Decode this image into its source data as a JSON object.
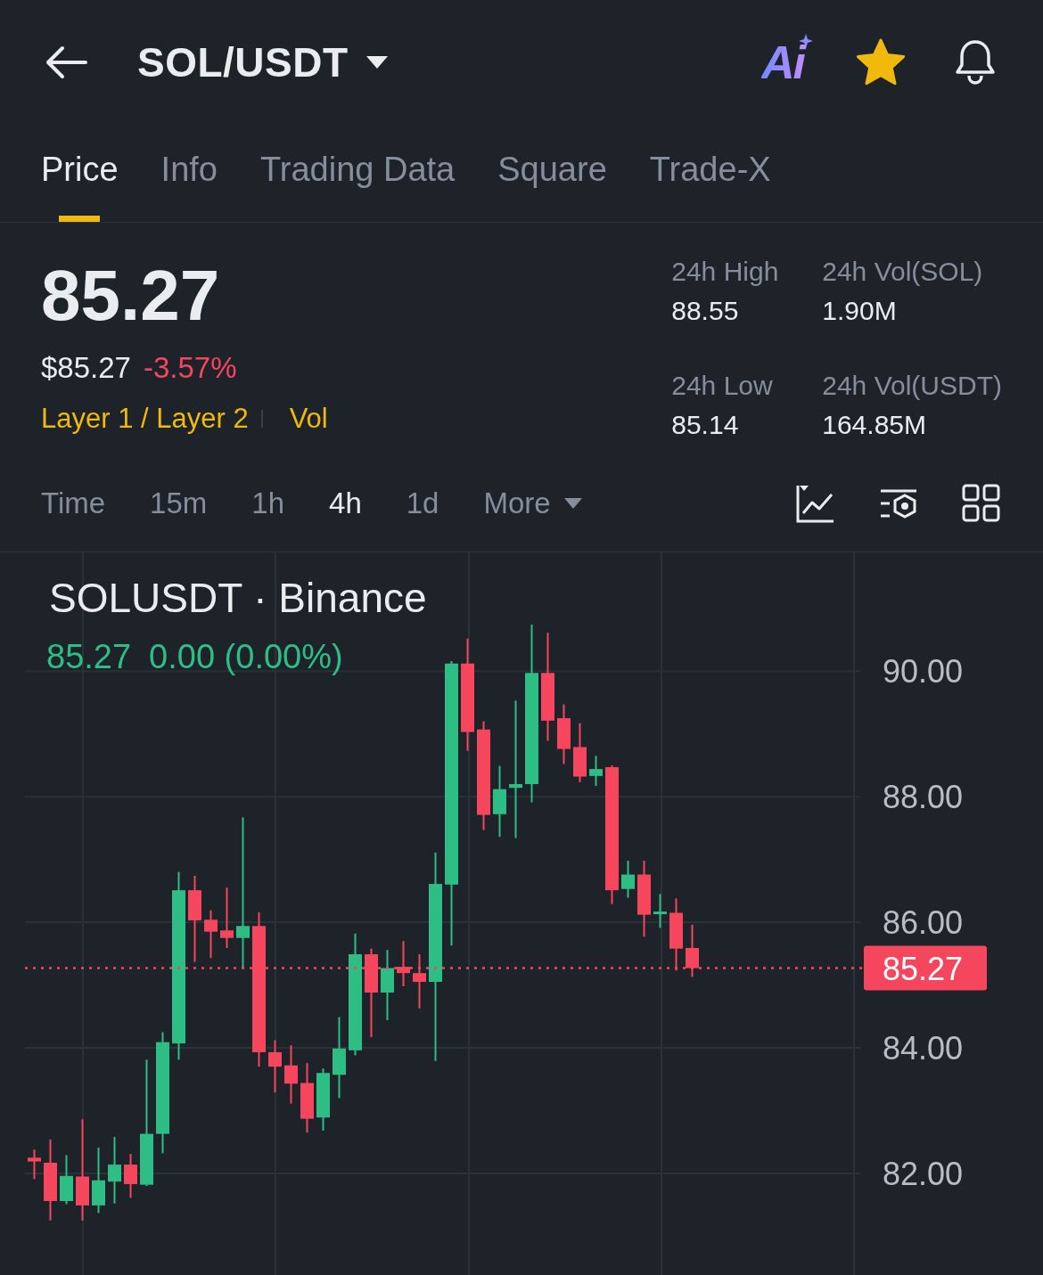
{
  "header": {
    "title": "SOL/USDT",
    "ai_label": "Ai",
    "favorite": true
  },
  "tabs": [
    {
      "label": "Price",
      "selected": true
    },
    {
      "label": "Info",
      "selected": false
    },
    {
      "label": "Trading Data",
      "selected": false
    },
    {
      "label": "Square",
      "selected": false
    },
    {
      "label": "Trade-X",
      "selected": false
    }
  ],
  "price": {
    "last": "85.27",
    "usd": "$85.27",
    "change": "-3.57%"
  },
  "tags": [
    "Layer 1 / Layer 2",
    "Vol"
  ],
  "stats": [
    {
      "label": "24h High",
      "value": "88.55"
    },
    {
      "label": "24h Vol(SOL)",
      "value": "1.90M"
    },
    {
      "label": "24h Low",
      "value": "85.14"
    },
    {
      "label": "24h Vol(USDT)",
      "value": "164.85M"
    }
  ],
  "intervals": [
    {
      "label": "Time",
      "selected": false,
      "kind": "option"
    },
    {
      "label": "15m",
      "selected": false,
      "kind": "option"
    },
    {
      "label": "1h",
      "selected": false,
      "kind": "option"
    },
    {
      "label": "4h",
      "selected": true,
      "kind": "option"
    },
    {
      "label": "1d",
      "selected": false,
      "kind": "option"
    },
    {
      "label": "More",
      "selected": false,
      "kind": "dropdown"
    }
  ],
  "chart": {
    "symbol": "SOLUSDT · Binance",
    "legend": {
      "price": "85.27",
      "change": "0.00 (0.00%)"
    },
    "chart_data": {
      "type": "candlestick",
      "grid": true,
      "ylim": [
        80.24,
        91.89
      ],
      "yticks": [
        {
          "value": 82,
          "label": "82.00"
        },
        {
          "value": 84,
          "label": "84.00"
        },
        {
          "value": 86,
          "label": "86.00"
        },
        {
          "value": 88,
          "label": "88.00"
        },
        {
          "value": 90,
          "label": "90.00"
        }
      ],
      "ohlc": [
        [
          82.25,
          82.38,
          81.91,
          82.19
        ],
        [
          82.17,
          82.54,
          81.25,
          81.56
        ],
        [
          81.56,
          82.29,
          81.51,
          81.96
        ],
        [
          81.95,
          82.86,
          81.25,
          81.49
        ],
        [
          81.49,
          82.41,
          81.37,
          81.89
        ],
        [
          81.87,
          82.58,
          81.52,
          82.14
        ],
        [
          82.14,
          82.31,
          81.61,
          81.83
        ],
        [
          81.82,
          83.81,
          81.8,
          82.63
        ],
        [
          82.63,
          84.25,
          82.32,
          84.09
        ],
        [
          84.07,
          86.8,
          83.81,
          86.51
        ],
        [
          86.51,
          86.74,
          85.37,
          86.03
        ],
        [
          86.04,
          86.19,
          85.43,
          85.85
        ],
        [
          85.87,
          86.55,
          85.59,
          85.75
        ],
        [
          85.75,
          87.67,
          85.27,
          85.94
        ],
        [
          85.94,
          86.16,
          83.7,
          83.93
        ],
        [
          83.93,
          84.12,
          83.29,
          83.7
        ],
        [
          83.72,
          84.04,
          83.11,
          83.43
        ],
        [
          83.44,
          83.76,
          82.65,
          82.87
        ],
        [
          82.89,
          83.67,
          82.68,
          83.6
        ],
        [
          83.57,
          84.49,
          83.2,
          83.99
        ],
        [
          83.96,
          85.82,
          83.88,
          85.49
        ],
        [
          85.49,
          85.58,
          84.17,
          84.88
        ],
        [
          84.88,
          85.56,
          84.44,
          85.27
        ],
        [
          85.29,
          85.7,
          84.98,
          85.19
        ],
        [
          85.19,
          85.49,
          84.63,
          85.05
        ],
        [
          85.05,
          87.11,
          83.79,
          86.61
        ],
        [
          86.6,
          90.16,
          85.63,
          90.12
        ],
        [
          90.12,
          90.52,
          88.73,
          89.03
        ],
        [
          89.07,
          89.2,
          87.47,
          87.71
        ],
        [
          87.72,
          88.49,
          87.36,
          88.12
        ],
        [
          88.14,
          89.53,
          87.34,
          88.2
        ],
        [
          88.2,
          90.74,
          87.91,
          89.97
        ],
        [
          89.97,
          90.61,
          88.89,
          89.21
        ],
        [
          89.25,
          89.47,
          88.52,
          88.76
        ],
        [
          88.79,
          89.17,
          88.23,
          88.32
        ],
        [
          88.33,
          88.65,
          88.17,
          88.44
        ],
        [
          88.47,
          88.5,
          86.29,
          86.51
        ],
        [
          86.53,
          86.98,
          86.39,
          86.76
        ],
        [
          86.76,
          86.98,
          85.77,
          86.12
        ],
        [
          86.13,
          86.45,
          85.91,
          86.17
        ],
        [
          86.15,
          86.38,
          85.23,
          85.58
        ],
        [
          85.59,
          85.96,
          85.13,
          85.27
        ],
        null,
        null,
        null,
        null,
        null,
        null,
        null,
        null,
        null,
        null
      ],
      "ref_lines": [
        {
          "axis": "y",
          "value": 85.27,
          "label": "85.27",
          "color": "#f6465d"
        }
      ]
    }
  }
}
